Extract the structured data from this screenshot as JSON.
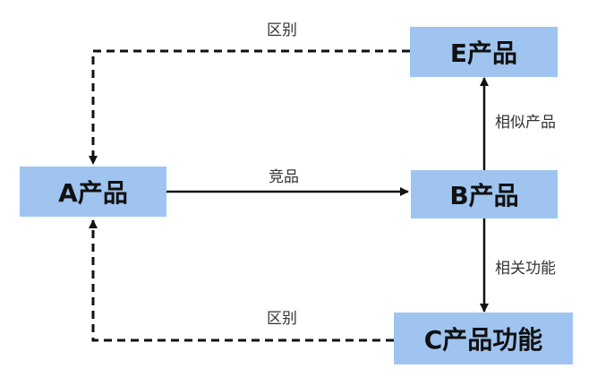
{
  "nodes": {
    "a": "A产品",
    "b": "B产品",
    "c": "C产品功能",
    "e": "E产品"
  },
  "edges": {
    "a_to_b": "竞品",
    "b_to_e": "相似产品",
    "b_to_c": "相关功能",
    "e_to_a": "区别",
    "c_to_a": "区别"
  },
  "colors": {
    "node_fill": "#9fc4f0",
    "line": "#111111",
    "text": "#111111"
  }
}
